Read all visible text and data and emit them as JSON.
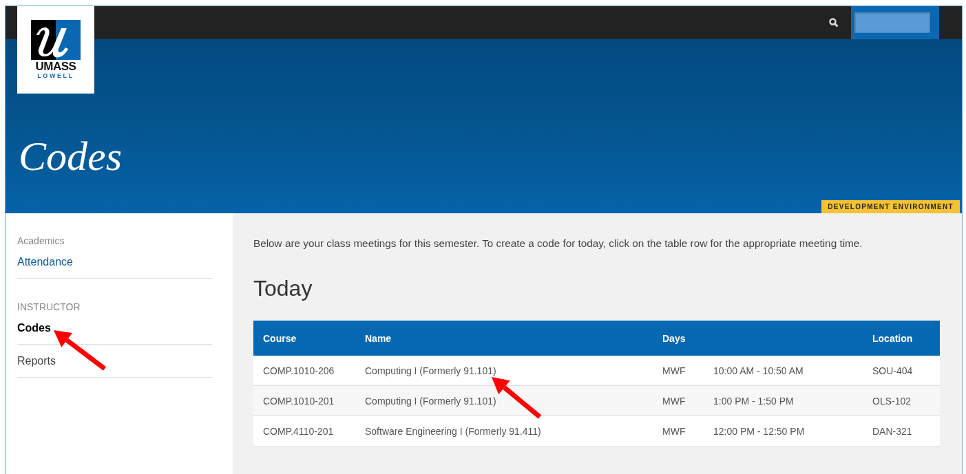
{
  "header": {
    "logo": {
      "line_1": "UMASS",
      "line_2": "LOWELL"
    }
  },
  "banner": {
    "title": "Codes",
    "badge": "DEVELOPMENT ENVIRONMENT"
  },
  "sidebar": {
    "groups": [
      {
        "heading": "Academics",
        "items": [
          {
            "label": "Attendance",
            "selected": false,
            "highlighted": true
          }
        ]
      },
      {
        "heading": "INSTRUCTOR",
        "items": [
          {
            "label": "Codes",
            "selected": true,
            "highlighted": false
          },
          {
            "label": "Reports",
            "selected": false,
            "highlighted": false
          }
        ]
      }
    ]
  },
  "main": {
    "intro": "Below are your class meetings for this semester. To create a code for today, click on the table row for the appropriate meeting time.",
    "heading": "Today",
    "table": {
      "columns": [
        {
          "label": "Course"
        },
        {
          "label": "Name"
        },
        {
          "label": "Days"
        },
        {},
        {
          "label": "Location"
        }
      ],
      "rows": [
        [
          "COMP.1010-206",
          "Computing I (Formerly 91.101)",
          "MWF",
          "10:00 AM - 10:50 AM",
          "SOU-404"
        ],
        [
          "COMP.1010-201",
          "Computing I (Formerly 91.101)",
          "MWF",
          "1:00 PM - 1:50 PM",
          "OLS-102"
        ],
        [
          "COMP.4110-201",
          "Software Engineering I (Formerly 91.411)",
          "MWF",
          "12:00 PM - 12:50 PM",
          "DAN-321"
        ]
      ]
    }
  }
}
